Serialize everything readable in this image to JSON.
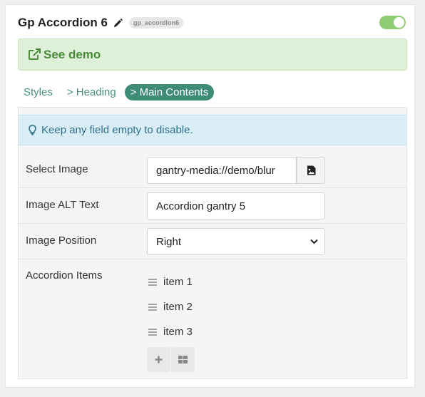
{
  "header": {
    "title": "Gp Accordion 6",
    "badge": "gp_accordion6",
    "enabled": true
  },
  "demo": {
    "label": "See demo"
  },
  "tabs": [
    {
      "label": "Styles",
      "active": false
    },
    {
      "label": "> Heading",
      "active": false
    },
    {
      "label": "> Main Contents",
      "active": true
    }
  ],
  "info": {
    "text": "Keep any field empty to disable."
  },
  "fields": {
    "image": {
      "label": "Select Image",
      "value": "gantry-media://demo/blur"
    },
    "alt": {
      "label": "Image ALT Text",
      "value": "Accordion gantry 5"
    },
    "position": {
      "label": "Image Position",
      "value": "Right"
    },
    "items": {
      "label": "Accordion Items"
    }
  },
  "accordion_items": [
    "item 1",
    "item 2",
    "item 3"
  ],
  "icons": {
    "edit": "pencil-icon",
    "demo": "external-link-icon",
    "info": "lightbulb-icon",
    "picker": "image-icon",
    "handle": "drag-handle-icon",
    "add": "plus-icon",
    "grid": "grid-icon"
  },
  "colors": {
    "toggle": "#8fcd72",
    "demo_bg": "#dff0d8",
    "demo_text": "#4a8a3a",
    "tab_active": "#3e8b76",
    "info_bg": "#d9edf7"
  }
}
